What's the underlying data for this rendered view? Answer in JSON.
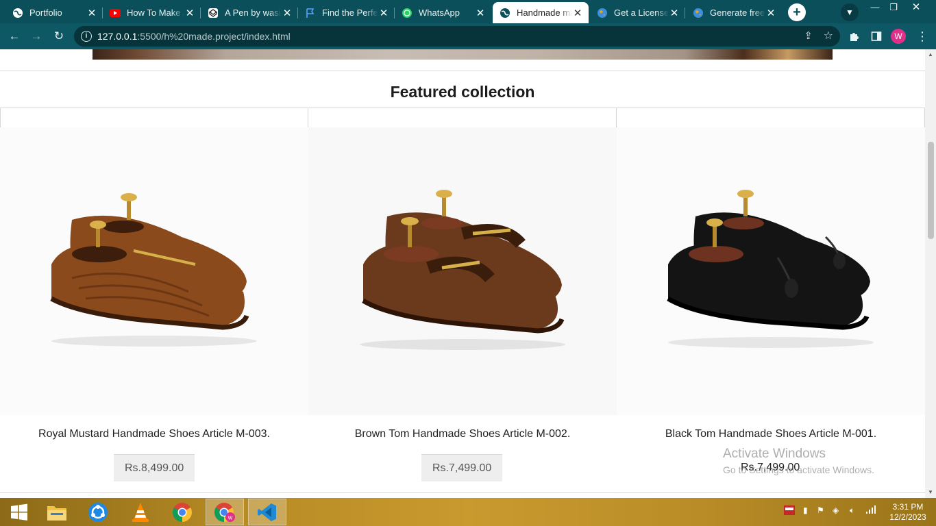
{
  "browser": {
    "tabs": [
      {
        "title": "Portfolio",
        "icon": "globe-icon"
      },
      {
        "title": "How To Make A",
        "icon": "youtube-icon"
      },
      {
        "title": "A Pen by wasil",
        "icon": "codepen-icon"
      },
      {
        "title": "Find the Perfect",
        "icon": "flag-icon"
      },
      {
        "title": "WhatsApp",
        "icon": "whatsapp-icon"
      },
      {
        "title": "Handmade made",
        "icon": "globe-icon",
        "active": true
      },
      {
        "title": "Get a License K",
        "icon": "earth-icon"
      },
      {
        "title": "Generate free T",
        "icon": "earth-icon"
      }
    ],
    "new_tab": "+",
    "url_host": "127.0.0.1",
    "url_path": ":5500/h%20made.project/index.html",
    "profile_initial": "W"
  },
  "page": {
    "section_title": "Featured collection",
    "products": [
      {
        "name": "Royal Mustard Handmade Shoes Article M-003.",
        "price": "Rs.8,499.00",
        "color": "#8a4a1c"
      },
      {
        "name": "Brown Tom Handmade Shoes Article M-002.",
        "price": "Rs.7,499.00",
        "color": "#6b3a1d"
      },
      {
        "name": "Black Tom Handmade Shoes Article M-001.",
        "price": "Rs.7,499.00",
        "color": "#141414"
      }
    ]
  },
  "watermark": {
    "line1": "Activate Windows",
    "line2": "Go to Settings to activate Windows."
  },
  "taskbar": {
    "time": "3:31 PM",
    "date": "12/2/2023"
  }
}
